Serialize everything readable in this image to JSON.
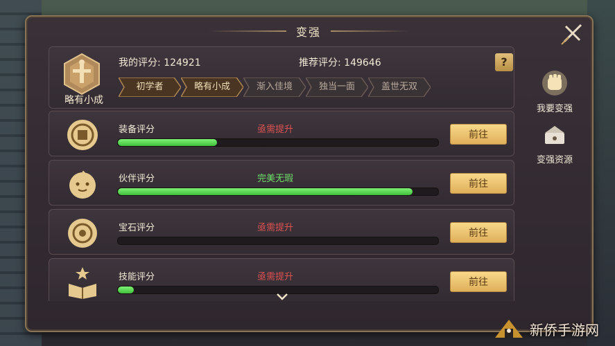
{
  "window": {
    "title": "变强"
  },
  "header": {
    "badge_label": "略有小成",
    "my_score_label": "我的评分:",
    "my_score_value": "124921",
    "recommended_label": "推荐评分:",
    "recommended_value": "149646",
    "help_label": "?",
    "ranks": [
      {
        "label": "初学者",
        "active": true
      },
      {
        "label": "略有小成",
        "active": true
      },
      {
        "label": "渐入佳境",
        "active": false
      },
      {
        "label": "独当一面",
        "active": false
      },
      {
        "label": "盖世无双",
        "active": false
      }
    ]
  },
  "rows": [
    {
      "label": "装备评分",
      "status": "亟需提升",
      "status_color": "#e05252",
      "progress": 0.31,
      "button": "前往",
      "icon": "equipment-icon"
    },
    {
      "label": "伙伴评分",
      "status": "完美无瑕",
      "status_color": "#6fe06a",
      "progress": 0.92,
      "button": "前往",
      "icon": "partner-icon"
    },
    {
      "label": "宝石评分",
      "status": "亟需提升",
      "status_color": "#e05252",
      "progress": 0.0,
      "button": "前往",
      "icon": "gem-icon"
    },
    {
      "label": "技能评分",
      "status": "亟需提升",
      "status_color": "#e05252",
      "progress": 0.05,
      "button": "前往",
      "icon": "skill-icon"
    }
  ],
  "side_menu": [
    {
      "label": "我要变强",
      "icon": "fist-icon"
    },
    {
      "label": "变强资源",
      "icon": "resource-chest-icon"
    }
  ],
  "watermark": {
    "text": "新侨手游网"
  },
  "colors": {
    "accent": "#e0b05a",
    "progress": "#5fd857",
    "bad": "#e05252",
    "good": "#6fe06a"
  }
}
